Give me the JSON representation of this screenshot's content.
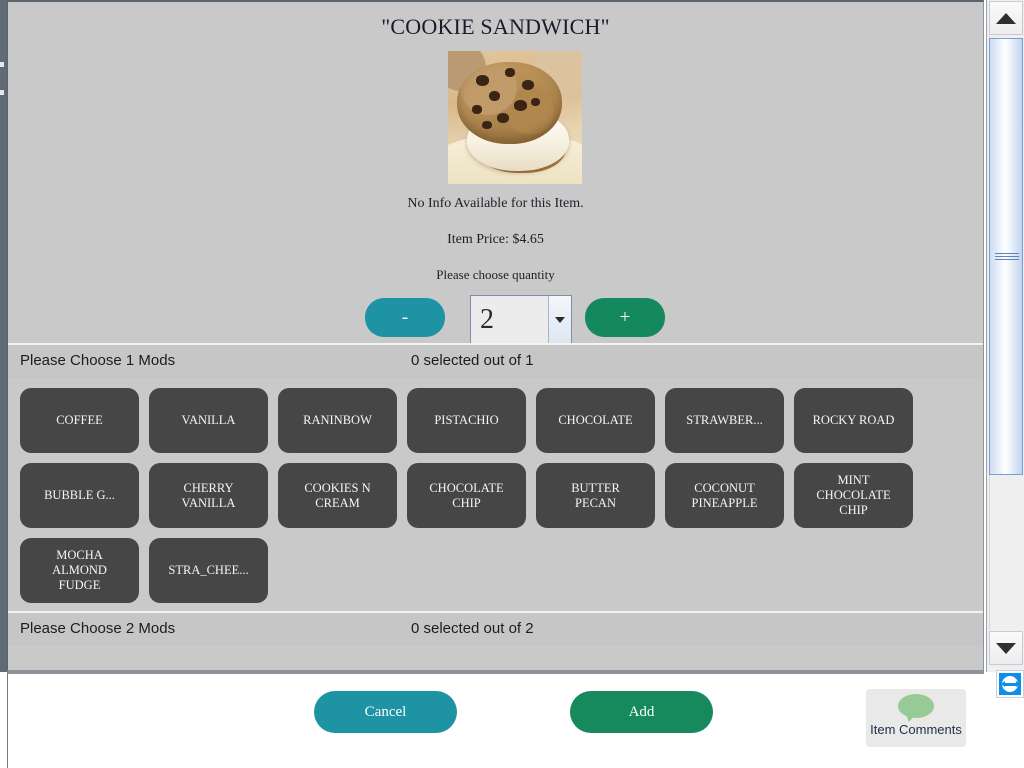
{
  "dialog": {
    "title": "\"COOKIE SANDWICH\"",
    "image_alt": "cookie-sandwich-photo",
    "no_info_text": "No Info Available for this Item.",
    "price_text": "Item Price: $4.65",
    "quantity_prompt": "Please choose quantity",
    "quantity_value": "2",
    "minus_label": "-",
    "plus_label": "+",
    "accent_teal": "#1e93a4",
    "accent_green": "#13895d",
    "mod_button_bg": "#464646",
    "dialog_bg": "#c9c9c9"
  },
  "mod_groups": [
    {
      "title": "Please Choose 1 Mods",
      "count_text": "0 selected out of 1",
      "options": [
        "COFFEE",
        "VANILLA",
        "RANINBOW",
        "PISTACHIO",
        "CHOCOLATE",
        "STRAWBER...",
        "ROCKY ROAD",
        "BUBBLE G...",
        "CHERRY\nVANILLA",
        "COOKIES N\nCREAM",
        "CHOCOLATE\nCHIP",
        "BUTTER\nPECAN",
        "COCONUT\nPINEAPPLE",
        "MINT\nCHOCOLATE\nCHIP",
        "MOCHA\nALMOND\nFUDGE",
        "STRA_CHEE..."
      ]
    },
    {
      "title": "Please Choose 2 Mods",
      "count_text": "0 selected out of 2",
      "options": []
    }
  ],
  "footer": {
    "cancel_label": "Cancel",
    "add_label": "Add",
    "comments_label": "Item Comments"
  },
  "scrollbar": {
    "up_icon": "triangle-up-icon",
    "down_icon": "triangle-down-icon",
    "thumb_icon": "scroll-thumb-grip"
  },
  "overlay": {
    "teamviewer_icon": "teamviewer-icon"
  }
}
